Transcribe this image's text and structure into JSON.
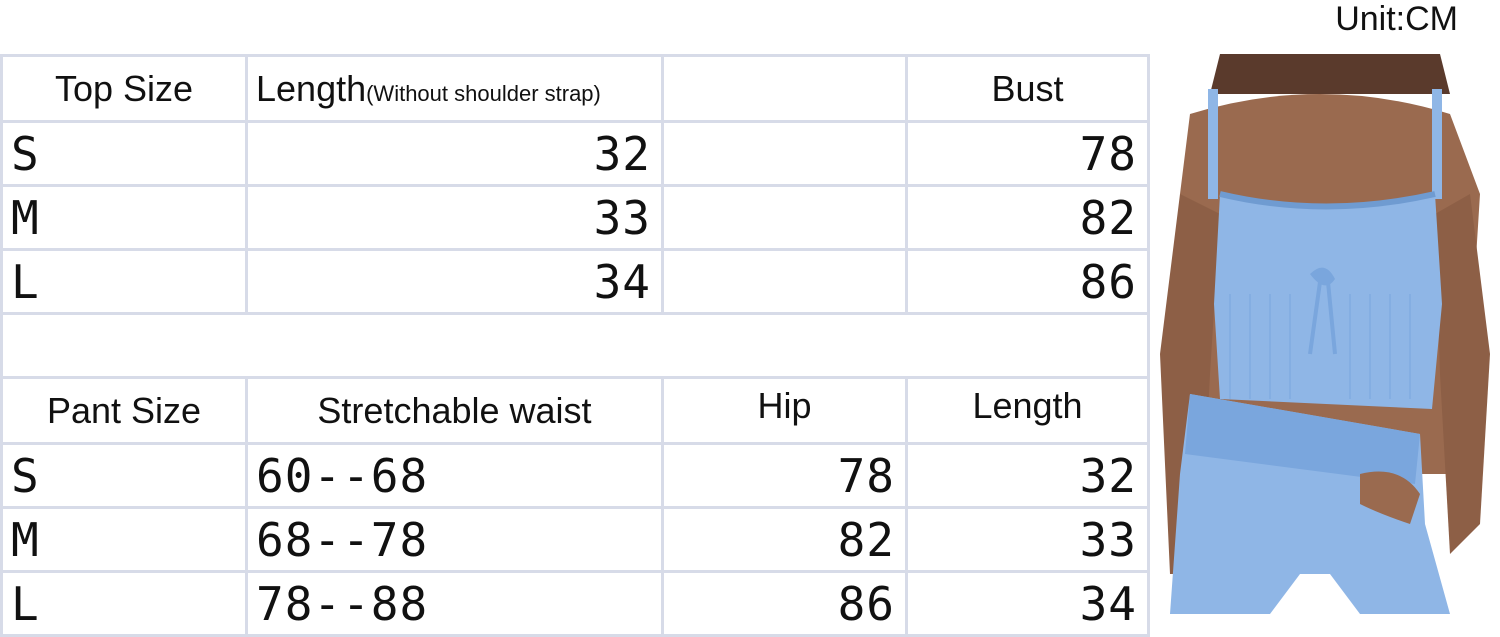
{
  "unit_label": "Unit:CM",
  "top_table": {
    "headers": [
      "Top Size",
      "Length",
      "(Without shoulder strap)",
      "",
      "Bust"
    ],
    "rows": [
      {
        "size": "S",
        "length": "32",
        "empty": "",
        "bust": "78"
      },
      {
        "size": "M",
        "length": "33",
        "empty": "",
        "bust": "82"
      },
      {
        "size": "L",
        "length": "34",
        "empty": "",
        "bust": "86"
      }
    ]
  },
  "pant_table": {
    "headers": [
      "Pant Size",
      "Stretchable waist",
      "Hip",
      "Length"
    ],
    "rows": [
      {
        "size": "S",
        "waist": "60--68",
        "hip": "78",
        "length": "32"
      },
      {
        "size": "M",
        "waist": "68--78",
        "hip": "82",
        "length": "33"
      },
      {
        "size": "L",
        "waist": "78--88",
        "hip": "86",
        "length": "34"
      }
    ]
  },
  "colors": {
    "grid_line": "#d7dbe8",
    "garment_blue": "#8fb6e6",
    "skin": "#9a6a4f"
  }
}
